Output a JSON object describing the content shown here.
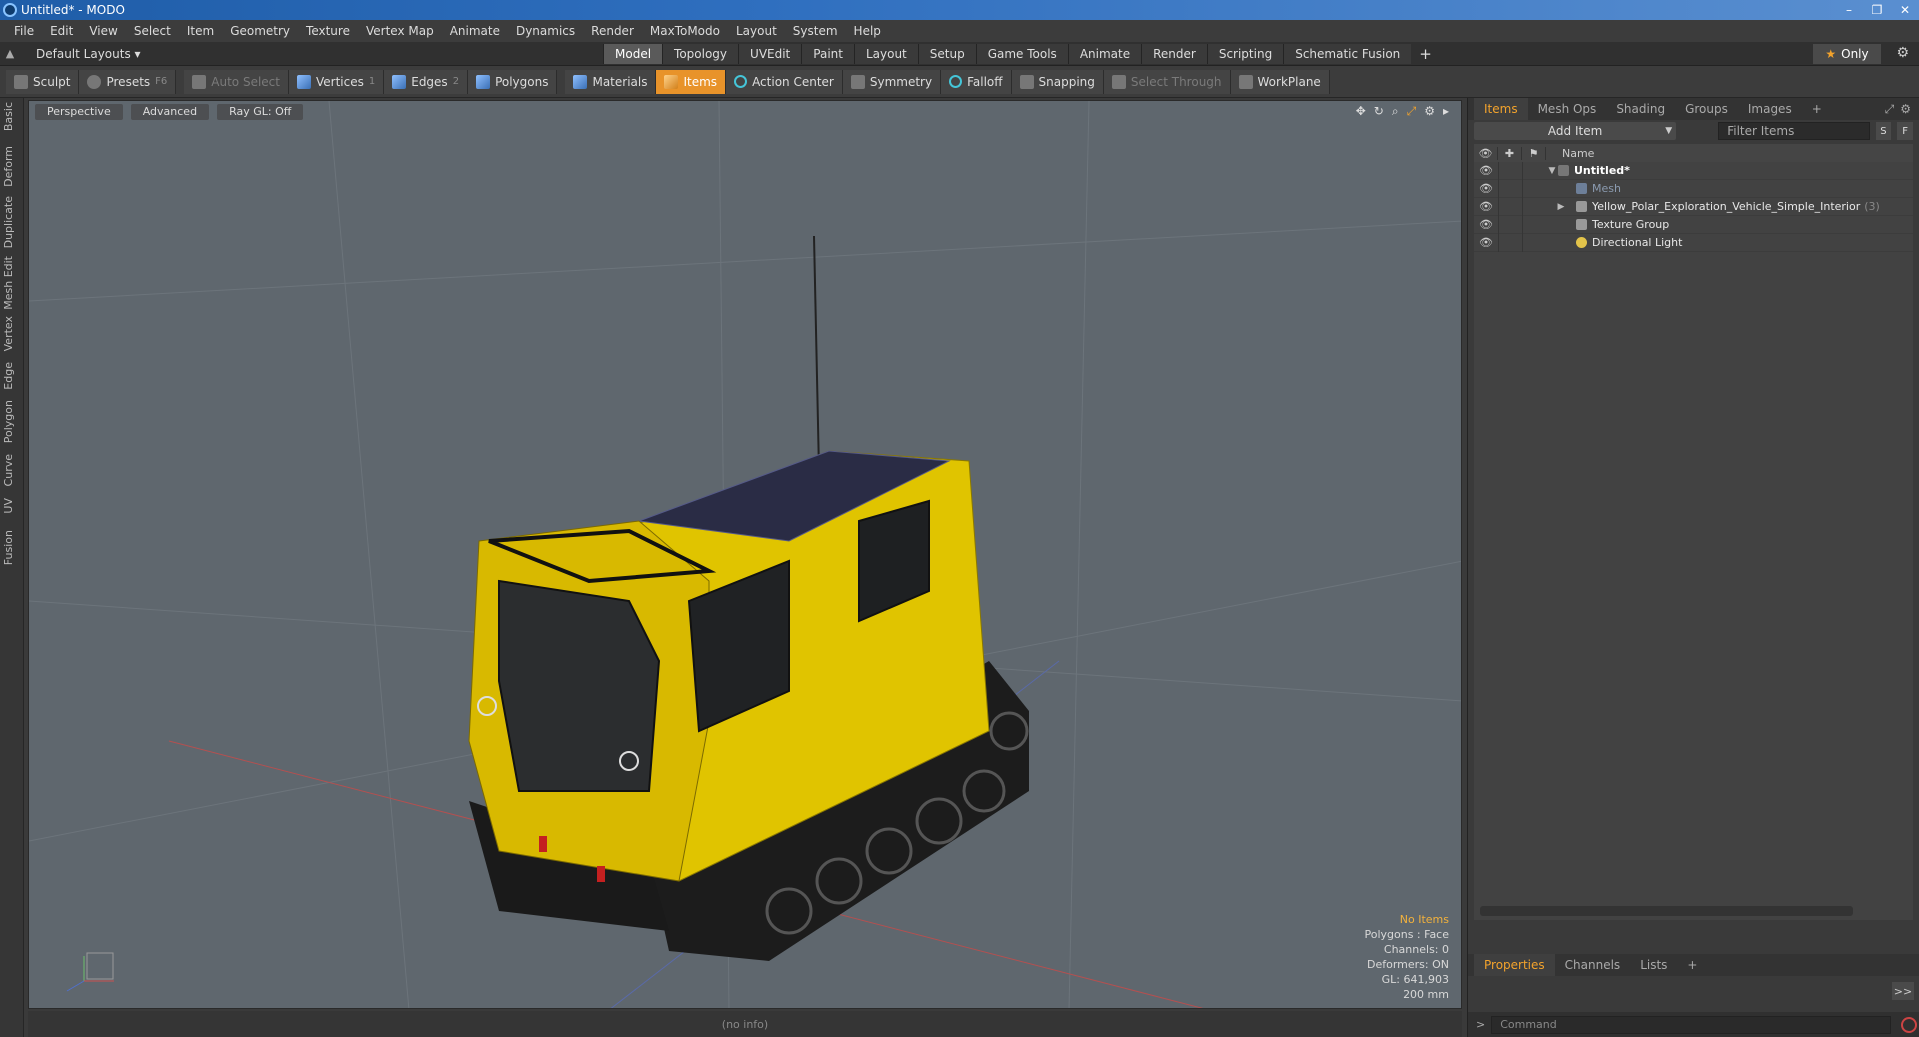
{
  "window": {
    "title": "Untitled* - MODO",
    "min": "–",
    "max": "❐",
    "close": "✕"
  },
  "menubar": [
    "File",
    "Edit",
    "View",
    "Select",
    "Item",
    "Geometry",
    "Texture",
    "Vertex Map",
    "Animate",
    "Dynamics",
    "Render",
    "MaxToModo",
    "Layout",
    "System",
    "Help"
  ],
  "layoutbar": {
    "layout_select": "Default Layouts ▾",
    "tabs": [
      "Model",
      "Topology",
      "UVEdit",
      "Paint",
      "Layout",
      "Setup",
      "Game Tools",
      "Animate",
      "Render",
      "Scripting",
      "Schematic Fusion"
    ],
    "active_tab": "Model",
    "add_tab": "+",
    "only_label": "Only",
    "star": "★",
    "gear": "⚙"
  },
  "toolbar": {
    "sculpt": "Sculpt",
    "presets": "Presets",
    "presets_key": "F6",
    "auto_select": "Auto Select",
    "vertices": "Vertices",
    "vertices_key": "1",
    "edges": "Edges",
    "edges_key": "2",
    "polygons": "Polygons",
    "materials": "Materials",
    "items": "Items",
    "action_center": "Action Center",
    "symmetry": "Symmetry",
    "falloff": "Falloff",
    "snapping": "Snapping",
    "select_through": "Select Through",
    "workplane": "WorkPlane"
  },
  "left_tabs": [
    "Basic",
    "Deform",
    "Duplicate",
    "Mesh Edit",
    "Vertex",
    "Edge",
    "Polygon",
    "Curve",
    "UV",
    "Fusion"
  ],
  "viewport": {
    "view_mode": "Perspective",
    "advanced": "Advanced",
    "raygl": "Ray GL: Off",
    "info": {
      "no_items": "No Items",
      "polygons": "Polygons : Face",
      "channels": "Channels: 0",
      "deformers": "Deformers: ON",
      "gl": "GL: 641,903",
      "scale": "200 mm"
    }
  },
  "status": "(no info)",
  "items_panel": {
    "tabs": [
      "Items",
      "Mesh Ops",
      "Shading",
      "Groups",
      "Images"
    ],
    "active_tab": "Items",
    "add_tab": "+",
    "add_item": "Add Item",
    "filter_placeholder": "Filter Items",
    "s_btn": "S",
    "f_btn": "F",
    "name_header": "Name",
    "tree": {
      "scene": "Untitled*",
      "mesh": "Mesh",
      "vehicle": "Yellow_Polar_Exploration_Vehicle_Simple_Interior",
      "vehicle_count": "(3)",
      "texture_group": "Texture Group",
      "light": "Directional Light"
    }
  },
  "properties_panel": {
    "tabs": [
      "Properties",
      "Channels",
      "Lists"
    ],
    "active_tab": "Properties",
    "add_tab": "+",
    "expand": ">>"
  },
  "command": {
    "placeholder": "Command"
  }
}
